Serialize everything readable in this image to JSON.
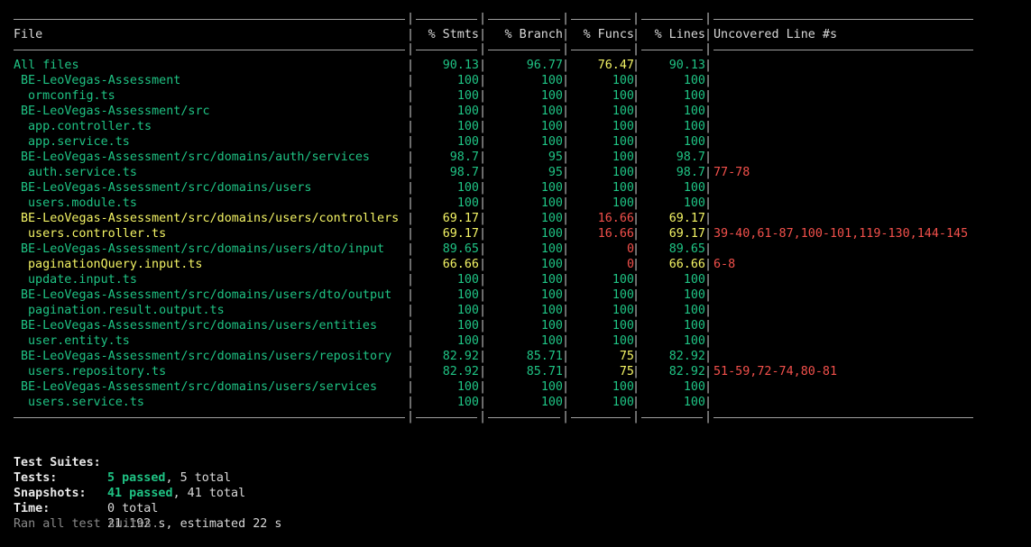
{
  "colors": {
    "green": "#1fc384",
    "yellow": "#f4f465",
    "red": "#f2504b",
    "background": "#000000"
  },
  "headers": {
    "file": "File",
    "stmts": "% Stmts",
    "branch": "% Branch",
    "funcs": "% Funcs",
    "lines": "% Lines",
    "uncovered": "Uncovered Line #s"
  },
  "rows": [
    {
      "file": "All files",
      "indent": 0,
      "stmts": "90.13",
      "branch": "96.77",
      "funcs": "76.47",
      "lines": "90.13",
      "uncovered": "",
      "fileColor": "green",
      "stmtsColor": "green",
      "branchColor": "green",
      "funcsColor": "yellow",
      "linesColor": "green"
    },
    {
      "file": "BE-LeoVegas-Assessment",
      "indent": 1,
      "stmts": "100",
      "branch": "100",
      "funcs": "100",
      "lines": "100",
      "uncovered": "",
      "fileColor": "green",
      "stmtsColor": "green",
      "branchColor": "green",
      "funcsColor": "green",
      "linesColor": "green"
    },
    {
      "file": "ormconfig.ts",
      "indent": 2,
      "stmts": "100",
      "branch": "100",
      "funcs": "100",
      "lines": "100",
      "uncovered": "",
      "fileColor": "green",
      "stmtsColor": "green",
      "branchColor": "green",
      "funcsColor": "green",
      "linesColor": "green"
    },
    {
      "file": "BE-LeoVegas-Assessment/src",
      "indent": 1,
      "stmts": "100",
      "branch": "100",
      "funcs": "100",
      "lines": "100",
      "uncovered": "",
      "fileColor": "green",
      "stmtsColor": "green",
      "branchColor": "green",
      "funcsColor": "green",
      "linesColor": "green"
    },
    {
      "file": "app.controller.ts",
      "indent": 2,
      "stmts": "100",
      "branch": "100",
      "funcs": "100",
      "lines": "100",
      "uncovered": "",
      "fileColor": "green",
      "stmtsColor": "green",
      "branchColor": "green",
      "funcsColor": "green",
      "linesColor": "green"
    },
    {
      "file": "app.service.ts",
      "indent": 2,
      "stmts": "100",
      "branch": "100",
      "funcs": "100",
      "lines": "100",
      "uncovered": "",
      "fileColor": "green",
      "stmtsColor": "green",
      "branchColor": "green",
      "funcsColor": "green",
      "linesColor": "green"
    },
    {
      "file": "BE-LeoVegas-Assessment/src/domains/auth/services",
      "indent": 1,
      "stmts": "98.7",
      "branch": "95",
      "funcs": "100",
      "lines": "98.7",
      "uncovered": "",
      "fileColor": "green",
      "stmtsColor": "green",
      "branchColor": "green",
      "funcsColor": "green",
      "linesColor": "green"
    },
    {
      "file": "auth.service.ts",
      "indent": 2,
      "stmts": "98.7",
      "branch": "95",
      "funcs": "100",
      "lines": "98.7",
      "uncovered": "77-78",
      "fileColor": "green",
      "stmtsColor": "green",
      "branchColor": "green",
      "funcsColor": "green",
      "linesColor": "green"
    },
    {
      "file": "BE-LeoVegas-Assessment/src/domains/users",
      "indent": 1,
      "stmts": "100",
      "branch": "100",
      "funcs": "100",
      "lines": "100",
      "uncovered": "",
      "fileColor": "green",
      "stmtsColor": "green",
      "branchColor": "green",
      "funcsColor": "green",
      "linesColor": "green"
    },
    {
      "file": "users.module.ts",
      "indent": 2,
      "stmts": "100",
      "branch": "100",
      "funcs": "100",
      "lines": "100",
      "uncovered": "",
      "fileColor": "green",
      "stmtsColor": "green",
      "branchColor": "green",
      "funcsColor": "green",
      "linesColor": "green"
    },
    {
      "file": "BE-LeoVegas-Assessment/src/domains/users/controllers",
      "indent": 1,
      "stmts": "69.17",
      "branch": "100",
      "funcs": "16.66",
      "lines": "69.17",
      "uncovered": "",
      "fileColor": "yellow",
      "stmtsColor": "yellow",
      "branchColor": "green",
      "funcsColor": "red",
      "linesColor": "yellow"
    },
    {
      "file": "users.controller.ts",
      "indent": 2,
      "stmts": "69.17",
      "branch": "100",
      "funcs": "16.66",
      "lines": "69.17",
      "uncovered": "39-40,61-87,100-101,119-130,144-145",
      "fileColor": "yellow",
      "stmtsColor": "yellow",
      "branchColor": "green",
      "funcsColor": "red",
      "linesColor": "yellow"
    },
    {
      "file": "BE-LeoVegas-Assessment/src/domains/users/dto/input",
      "indent": 1,
      "stmts": "89.65",
      "branch": "100",
      "funcs": "0",
      "lines": "89.65",
      "uncovered": "",
      "fileColor": "green",
      "stmtsColor": "green",
      "branchColor": "green",
      "funcsColor": "red",
      "linesColor": "green"
    },
    {
      "file": "paginationQuery.input.ts",
      "indent": 2,
      "stmts": "66.66",
      "branch": "100",
      "funcs": "0",
      "lines": "66.66",
      "uncovered": "6-8",
      "fileColor": "yellow",
      "stmtsColor": "yellow",
      "branchColor": "green",
      "funcsColor": "red",
      "linesColor": "yellow"
    },
    {
      "file": "update.input.ts",
      "indent": 2,
      "stmts": "100",
      "branch": "100",
      "funcs": "100",
      "lines": "100",
      "uncovered": "",
      "fileColor": "green",
      "stmtsColor": "green",
      "branchColor": "green",
      "funcsColor": "green",
      "linesColor": "green"
    },
    {
      "file": "BE-LeoVegas-Assessment/src/domains/users/dto/output",
      "indent": 1,
      "stmts": "100",
      "branch": "100",
      "funcs": "100",
      "lines": "100",
      "uncovered": "",
      "fileColor": "green",
      "stmtsColor": "green",
      "branchColor": "green",
      "funcsColor": "green",
      "linesColor": "green"
    },
    {
      "file": "pagination.result.output.ts",
      "indent": 2,
      "stmts": "100",
      "branch": "100",
      "funcs": "100",
      "lines": "100",
      "uncovered": "",
      "fileColor": "green",
      "stmtsColor": "green",
      "branchColor": "green",
      "funcsColor": "green",
      "linesColor": "green"
    },
    {
      "file": "BE-LeoVegas-Assessment/src/domains/users/entities",
      "indent": 1,
      "stmts": "100",
      "branch": "100",
      "funcs": "100",
      "lines": "100",
      "uncovered": "",
      "fileColor": "green",
      "stmtsColor": "green",
      "branchColor": "green",
      "funcsColor": "green",
      "linesColor": "green"
    },
    {
      "file": "user.entity.ts",
      "indent": 2,
      "stmts": "100",
      "branch": "100",
      "funcs": "100",
      "lines": "100",
      "uncovered": "",
      "fileColor": "green",
      "stmtsColor": "green",
      "branchColor": "green",
      "funcsColor": "green",
      "linesColor": "green"
    },
    {
      "file": "BE-LeoVegas-Assessment/src/domains/users/repository",
      "indent": 1,
      "stmts": "82.92",
      "branch": "85.71",
      "funcs": "75",
      "lines": "82.92",
      "uncovered": "",
      "fileColor": "green",
      "stmtsColor": "green",
      "branchColor": "green",
      "funcsColor": "yellow",
      "linesColor": "green"
    },
    {
      "file": "users.repository.ts",
      "indent": 2,
      "stmts": "82.92",
      "branch": "85.71",
      "funcs": "75",
      "lines": "82.92",
      "uncovered": "51-59,72-74,80-81",
      "fileColor": "green",
      "stmtsColor": "green",
      "branchColor": "green",
      "funcsColor": "yellow",
      "linesColor": "green"
    },
    {
      "file": "BE-LeoVegas-Assessment/src/domains/users/services",
      "indent": 1,
      "stmts": "100",
      "branch": "100",
      "funcs": "100",
      "lines": "100",
      "uncovered": "",
      "fileColor": "green",
      "stmtsColor": "green",
      "branchColor": "green",
      "funcsColor": "green",
      "linesColor": "green"
    },
    {
      "file": "users.service.ts",
      "indent": 2,
      "stmts": "100",
      "branch": "100",
      "funcs": "100",
      "lines": "100",
      "uncovered": "",
      "fileColor": "green",
      "stmtsColor": "green",
      "branchColor": "green",
      "funcsColor": "green",
      "linesColor": "green"
    }
  ],
  "summary": {
    "suites_label": "Test Suites:",
    "suites_passed": "5 passed",
    "suites_rest": ", 5 total",
    "tests_label": "Tests:",
    "tests_passed": "41 passed",
    "tests_rest": ", 41 total",
    "snapshots_label": "Snapshots:",
    "snapshots_value": "0 total",
    "time_label": "Time:",
    "time_value": "21.192 s, estimated 22 s",
    "ran_text": "Ran all test suites."
  }
}
